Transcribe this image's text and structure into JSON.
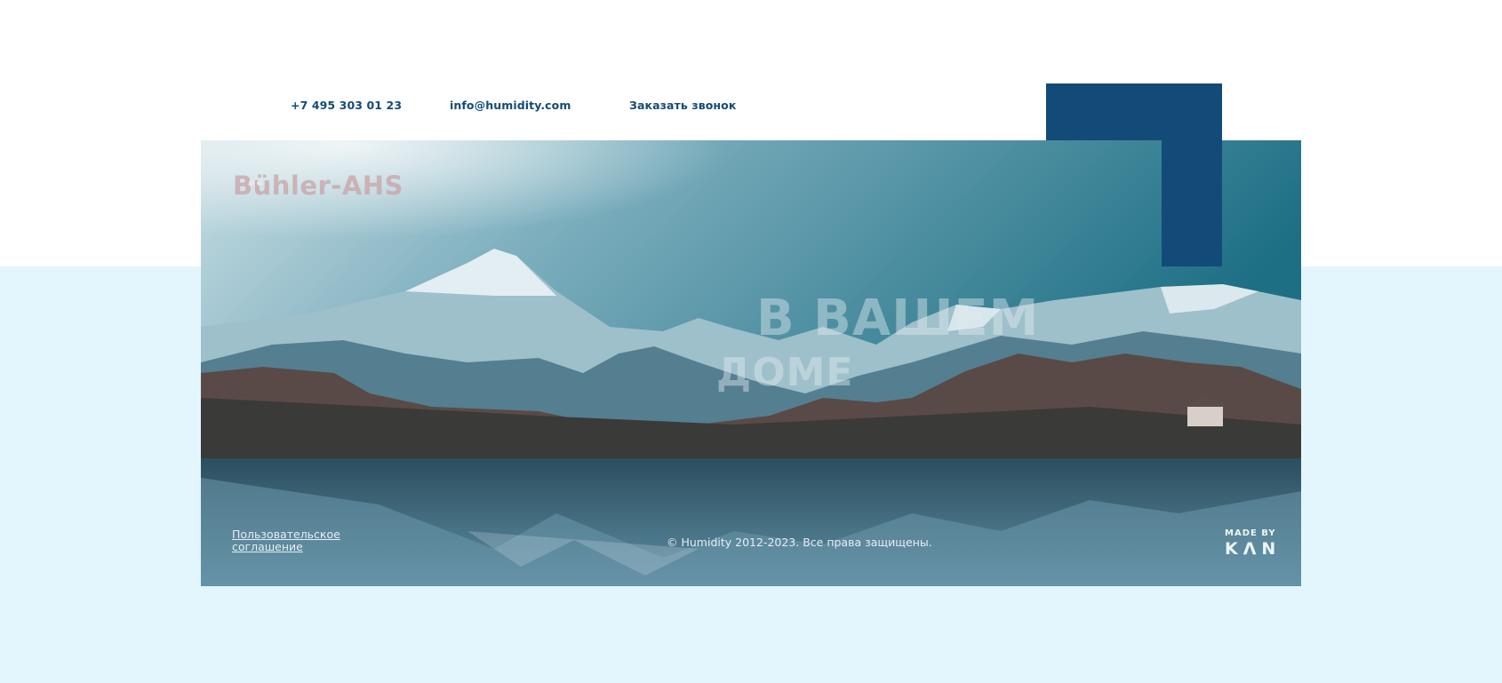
{
  "header": {
    "phone": "+7 495 303 01 23",
    "email": "info@humidity.com",
    "callback": "Заказать звонок"
  },
  "hero": {
    "logo": "Bühler-AHS",
    "headline_line1": "В ВАШЕМ",
    "headline_line2": "ДОМЕ"
  },
  "footer": {
    "agreement": "Пользовательское соглашение",
    "copyright": "© Humidity 2012-2023. Все права защищены.",
    "made_by_label": "MADE BY",
    "made_by_brand": "KΛN"
  },
  "colors": {
    "brand_blue": "#134b78",
    "page_bottom_bg": "#e3f6fd",
    "hero_text": "#e6eef2"
  },
  "icons": [
    "mountain-landscape-image",
    "logo-dots-icon"
  ]
}
